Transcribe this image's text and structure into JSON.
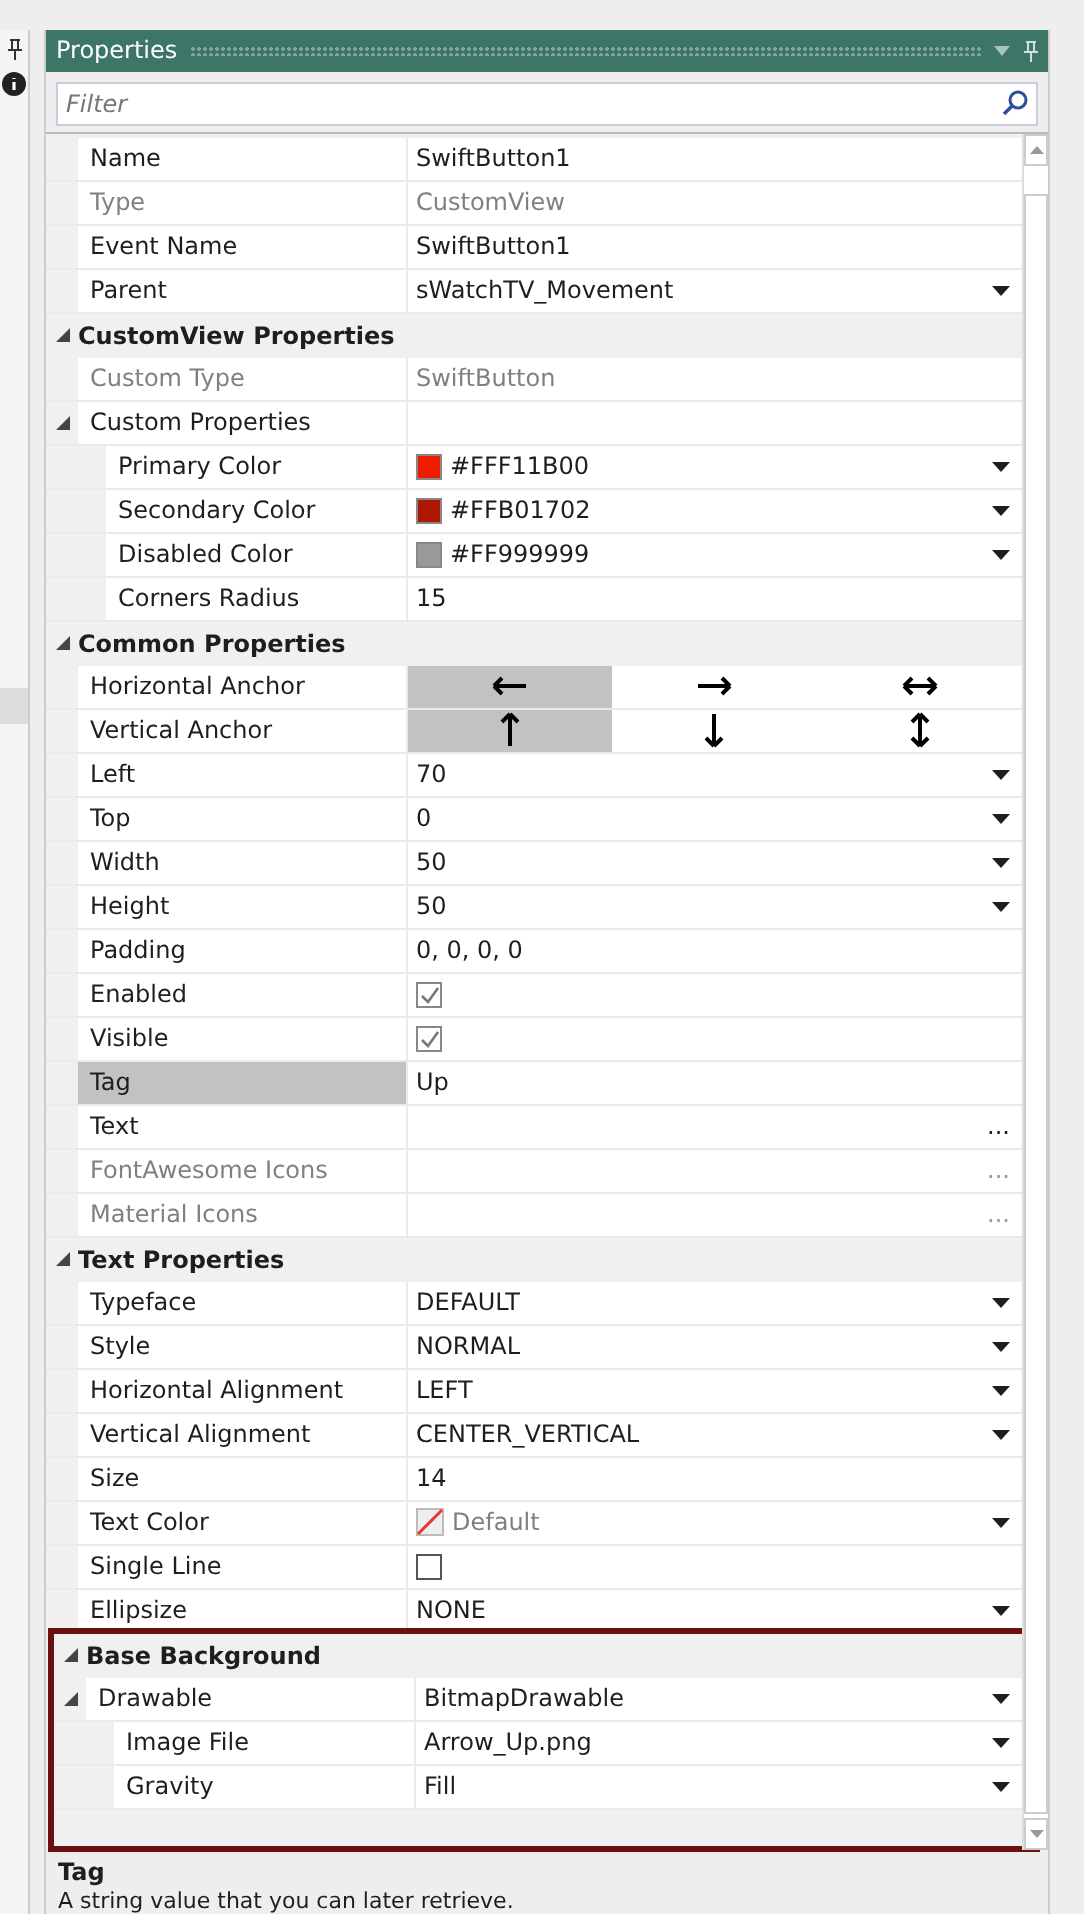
{
  "panel": {
    "title": "Properties"
  },
  "filter": {
    "placeholder": "Filter"
  },
  "rows": [
    {
      "kind": "text",
      "label": "Name",
      "value": "SwiftButton1",
      "disabled": false,
      "dropdown": false,
      "selected": false
    },
    {
      "kind": "text",
      "label": "Type",
      "value": "CustomView",
      "disabled": true,
      "dropdown": false,
      "selected": false
    },
    {
      "kind": "text",
      "label": "Event Name",
      "value": "SwiftButton1",
      "disabled": false,
      "dropdown": false,
      "selected": false
    },
    {
      "kind": "text",
      "label": "Parent",
      "value": "sWatchTV_Movement",
      "disabled": false,
      "dropdown": true,
      "selected": false
    },
    {
      "kind": "category",
      "label": "CustomView Properties",
      "expanded": true,
      "highlighted": false,
      "children": [
        {
          "kind": "text",
          "label": "Custom Type",
          "value": "SwiftButton",
          "disabled": true,
          "dropdown": false,
          "selected": false
        },
        {
          "kind": "group",
          "label": "Custom Properties",
          "expanded": true,
          "selected": false,
          "children": [
            {
              "kind": "color",
              "label": "Primary Color",
              "value": "#FFF11B00",
              "color": "#f11b00",
              "dropdown": true,
              "selected": false
            },
            {
              "kind": "color",
              "label": "Secondary Color",
              "value": "#FFB01702",
              "color": "#b01702",
              "dropdown": true,
              "selected": false
            },
            {
              "kind": "color",
              "label": "Disabled Color",
              "value": "#FF999999",
              "color": "#999999",
              "dropdown": true,
              "selected": false
            },
            {
              "kind": "text",
              "label": "Corners Radius",
              "value": "15",
              "disabled": false,
              "dropdown": false,
              "selected": false
            }
          ]
        }
      ]
    },
    {
      "kind": "category",
      "label": "Common Properties",
      "expanded": true,
      "highlighted": false,
      "children": [
        {
          "kind": "anchor",
          "label": "Horizontal Anchor",
          "selected": false,
          "options": [
            {
              "kind": "left",
              "selected": true
            },
            {
              "kind": "right",
              "selected": false
            },
            {
              "kind": "both-horizontal",
              "selected": false
            }
          ]
        },
        {
          "kind": "anchor",
          "label": "Vertical Anchor",
          "selected": false,
          "options": [
            {
              "kind": "up",
              "selected": true
            },
            {
              "kind": "down",
              "selected": false
            },
            {
              "kind": "both-vertical",
              "selected": false
            }
          ]
        },
        {
          "kind": "text",
          "label": "Left",
          "value": "70",
          "disabled": false,
          "dropdown": true,
          "selected": false
        },
        {
          "kind": "text",
          "label": "Top",
          "value": "0",
          "disabled": false,
          "dropdown": true,
          "selected": false
        },
        {
          "kind": "text",
          "label": "Width",
          "value": "50",
          "disabled": false,
          "dropdown": true,
          "selected": false
        },
        {
          "kind": "text",
          "label": "Height",
          "value": "50",
          "disabled": false,
          "dropdown": true,
          "selected": false
        },
        {
          "kind": "text",
          "label": "Padding",
          "value": "0, 0, 0, 0",
          "disabled": false,
          "dropdown": false,
          "selected": false
        },
        {
          "kind": "checkbox",
          "label": "Enabled",
          "checked": true,
          "selected": false
        },
        {
          "kind": "checkbox",
          "label": "Visible",
          "checked": true,
          "selected": false
        },
        {
          "kind": "text",
          "label": "Tag",
          "value": "Up",
          "disabled": false,
          "dropdown": false,
          "selected": true
        },
        {
          "kind": "ellipsis",
          "label": "Text",
          "button": "...",
          "disabled": false,
          "selected": false
        },
        {
          "kind": "ellipsis",
          "label": "FontAwesome Icons",
          "button": "...",
          "disabled": true,
          "selected": false
        },
        {
          "kind": "ellipsis",
          "label": "Material Icons",
          "button": "...",
          "disabled": true,
          "selected": false
        }
      ]
    },
    {
      "kind": "category",
      "label": "Text Properties",
      "expanded": true,
      "highlighted": false,
      "children": [
        {
          "kind": "text",
          "label": "Typeface",
          "value": "DEFAULT",
          "disabled": false,
          "dropdown": true,
          "selected": false
        },
        {
          "kind": "text",
          "label": "Style",
          "value": "NORMAL",
          "disabled": false,
          "dropdown": true,
          "selected": false
        },
        {
          "kind": "text",
          "label": "Horizontal Alignment",
          "value": "LEFT",
          "disabled": false,
          "dropdown": true,
          "selected": false
        },
        {
          "kind": "text",
          "label": "Vertical Alignment",
          "value": "CENTER_VERTICAL",
          "disabled": false,
          "dropdown": true,
          "selected": false
        },
        {
          "kind": "text",
          "label": "Size",
          "value": "14",
          "disabled": false,
          "dropdown": false,
          "selected": false
        },
        {
          "kind": "textcolor",
          "label": "Text Color",
          "value": "Default",
          "dropdown": true,
          "selected": false
        },
        {
          "kind": "checkbox",
          "label": "Single Line",
          "checked": false,
          "selected": false
        },
        {
          "kind": "text",
          "label": "Ellipsize",
          "value": "NONE",
          "disabled": false,
          "dropdown": true,
          "selected": false
        }
      ]
    },
    {
      "kind": "category",
      "label": "Base Background",
      "expanded": true,
      "highlighted": true,
      "children": [
        {
          "kind": "group",
          "label": "Drawable",
          "value": "BitmapDrawable",
          "dropdown": true,
          "expanded": true,
          "selected": false,
          "children": [
            {
              "kind": "text",
              "label": "Image File",
              "value": "Arrow_Up.png",
              "disabled": false,
              "dropdown": true,
              "selected": false
            },
            {
              "kind": "text",
              "label": "Gravity",
              "value": "Fill",
              "disabled": false,
              "dropdown": true,
              "selected": false
            }
          ]
        }
      ]
    }
  ],
  "description": {
    "title": "Tag",
    "text": "A string value that you can later retrieve."
  }
}
